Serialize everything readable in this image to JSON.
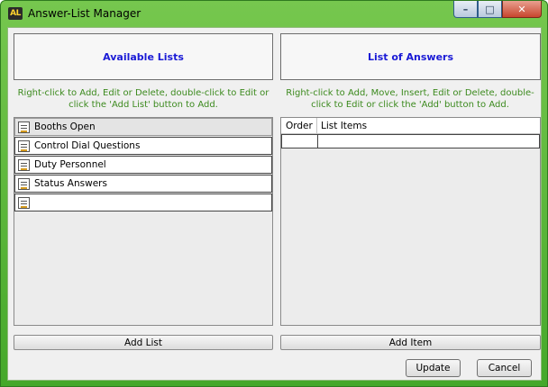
{
  "window": {
    "title": "Answer-List Manager",
    "app_icon_text": "AL",
    "minimize_glyph": "–",
    "maximize_glyph": "□",
    "close_glyph": "✕"
  },
  "left_panel": {
    "header": "Available Lists",
    "hint": "Right-click to Add, Edit or Delete, double-click to Edit or click the 'Add List' button to Add.",
    "items": [
      {
        "label": "Booths Open",
        "selected": true
      },
      {
        "label": "Control Dial Questions",
        "selected": false
      },
      {
        "label": "Duty Personnel",
        "selected": false
      },
      {
        "label": "Status Answers",
        "selected": false
      },
      {
        "label": "",
        "selected": false
      }
    ],
    "add_button": "Add List"
  },
  "right_panel": {
    "header": "List of Answers",
    "hint": "Right-click to Add, Move, Insert, Edit or Delete, double-click to Edit or click the 'Add' button to Add.",
    "columns": [
      "Order",
      "List Items"
    ],
    "rows": [
      [
        "",
        ""
      ]
    ],
    "add_button": "Add Item"
  },
  "footer": {
    "update_button": "Update",
    "cancel_button": "Cancel"
  },
  "colors": {
    "header_text": "#1a1ad6",
    "hint_text": "#3c8a1e",
    "frame_green": "#45a82a"
  }
}
